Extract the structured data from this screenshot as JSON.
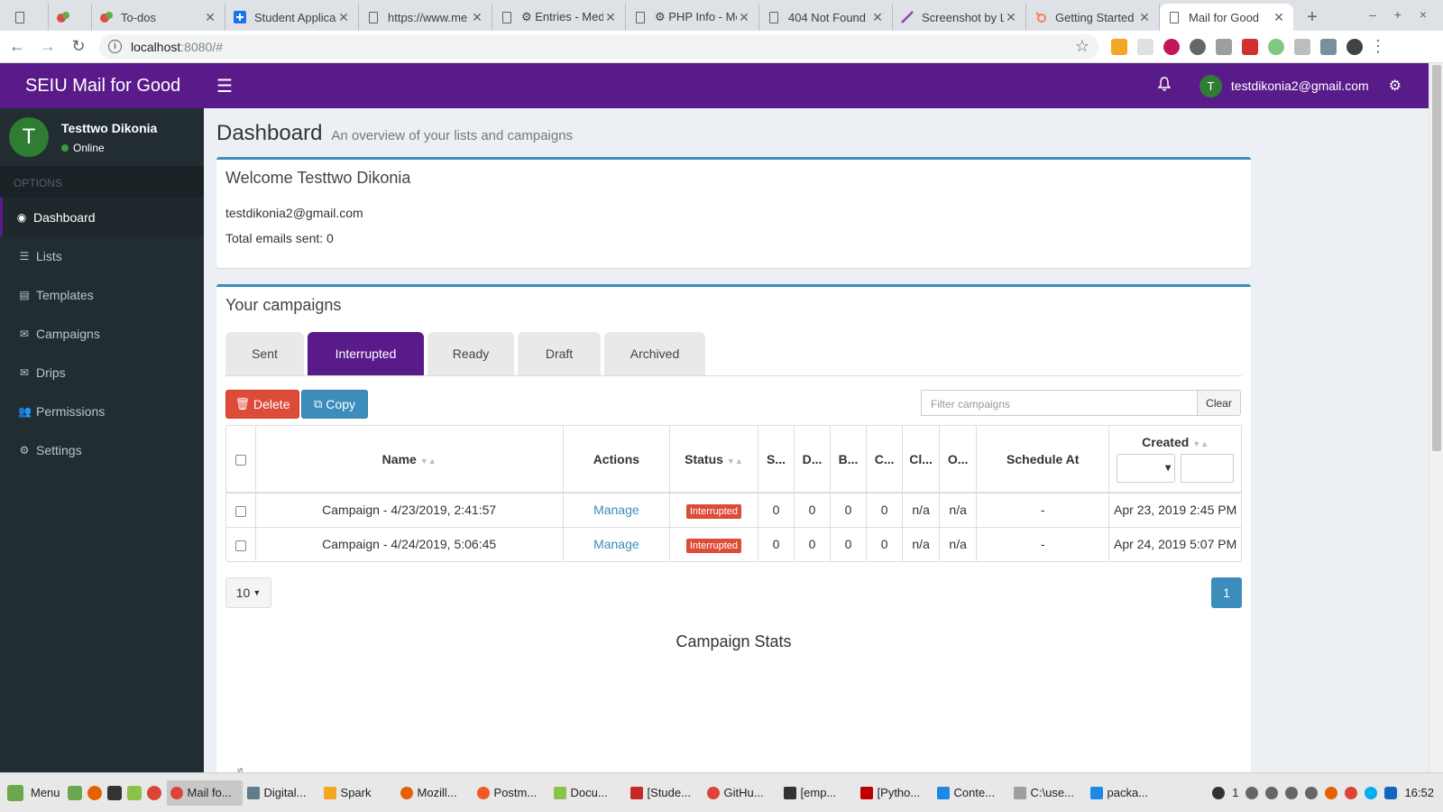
{
  "browser": {
    "tabs": [
      {
        "title": "",
        "icon": "page-icon"
      },
      {
        "title": "",
        "icon": "todoist-icon"
      },
      {
        "title": "To-dos",
        "icon": "todoist-icon"
      },
      {
        "title": "Student Applica",
        "icon": "plus-square-icon"
      },
      {
        "title": "https://www.me",
        "icon": "page-icon"
      },
      {
        "title": "⚙ Entries - Med",
        "icon": "page-icon"
      },
      {
        "title": "⚙ PHP Info - Me",
        "icon": "page-icon"
      },
      {
        "title": "404 Not Found",
        "icon": "page-icon"
      },
      {
        "title": "Screenshot by L",
        "icon": "feather-icon"
      },
      {
        "title": "Getting Started",
        "icon": "hubspot-icon"
      },
      {
        "title": "Mail for Good",
        "icon": "page-icon",
        "active": true
      }
    ],
    "url_host": "localhost",
    "url_rest": ":8080/#",
    "window_controls": "– + ×"
  },
  "header": {
    "brand": "SEIU Mail for Good",
    "user_initial": "T",
    "user_email": "testdikonia2@gmail.com",
    "color": "#5a1b8a"
  },
  "sidebar": {
    "user_initial": "T",
    "user_name": "Testtwo Dikonia",
    "status": "Online",
    "section_header": "OPTIONS",
    "items": [
      {
        "label": "Dashboard",
        "icon": "dashboard-icon",
        "active": true
      },
      {
        "label": "Lists",
        "icon": "list-icon"
      },
      {
        "label": "Templates",
        "icon": "file-icon"
      },
      {
        "label": "Campaigns",
        "icon": "envelope-icon"
      },
      {
        "label": "Drips",
        "icon": "envelope-icon"
      },
      {
        "label": "Permissions",
        "icon": "users-icon"
      },
      {
        "label": "Settings",
        "icon": "gear-icon"
      }
    ]
  },
  "page": {
    "title": "Dashboard",
    "subtitle": "An overview of your lists and campaigns"
  },
  "welcome": {
    "title": "Welcome Testtwo Dikonia",
    "email": "testdikonia2@gmail.com",
    "total_sent": "Total emails sent: 0"
  },
  "campaigns": {
    "title": "Your campaigns",
    "tabs": [
      "Sent",
      "Interrupted",
      "Ready",
      "Draft",
      "Archived"
    ],
    "active_tab": "Interrupted",
    "delete_label": "Delete",
    "copy_label": "Copy",
    "filter_placeholder": "Filter campaigns",
    "clear_label": "Clear",
    "columns": [
      "Name",
      "Actions",
      "Status",
      "S...",
      "D...",
      "B...",
      "C...",
      "Cl...",
      "O...",
      "Schedule At",
      "Created"
    ],
    "rows": [
      {
        "name": "Campaign - 4/23/2019, 2:41:57",
        "action": "Manage",
        "status": "Interrupted",
        "s": "0",
        "d": "0",
        "b": "0",
        "c": "0",
        "cl": "n/a",
        "o": "n/a",
        "schedule": "-",
        "created": "Apr 23, 2019 2:45 PM"
      },
      {
        "name": "Campaign - 4/24/2019, 5:06:45",
        "action": "Manage",
        "status": "Interrupted",
        "s": "0",
        "d": "0",
        "b": "0",
        "c": "0",
        "cl": "n/a",
        "o": "n/a",
        "schedule": "-",
        "created": "Apr 24, 2019 5:07 PM"
      }
    ],
    "page_size": "10",
    "current_page": "1",
    "stats_title": "Campaign Stats",
    "stats_stub_text": "s"
  },
  "taskbar": {
    "menu_label": "Menu",
    "items": [
      "Mail fo...",
      "Digital...",
      "Spark",
      "Mozill...",
      "Postm...",
      "Docu...",
      "[Stude...",
      "GitHu...",
      "[emp...",
      "[Pytho...",
      "Conte...",
      "C:\\use...",
      "packa..."
    ],
    "tray_count": "1",
    "clock": "16:52"
  }
}
